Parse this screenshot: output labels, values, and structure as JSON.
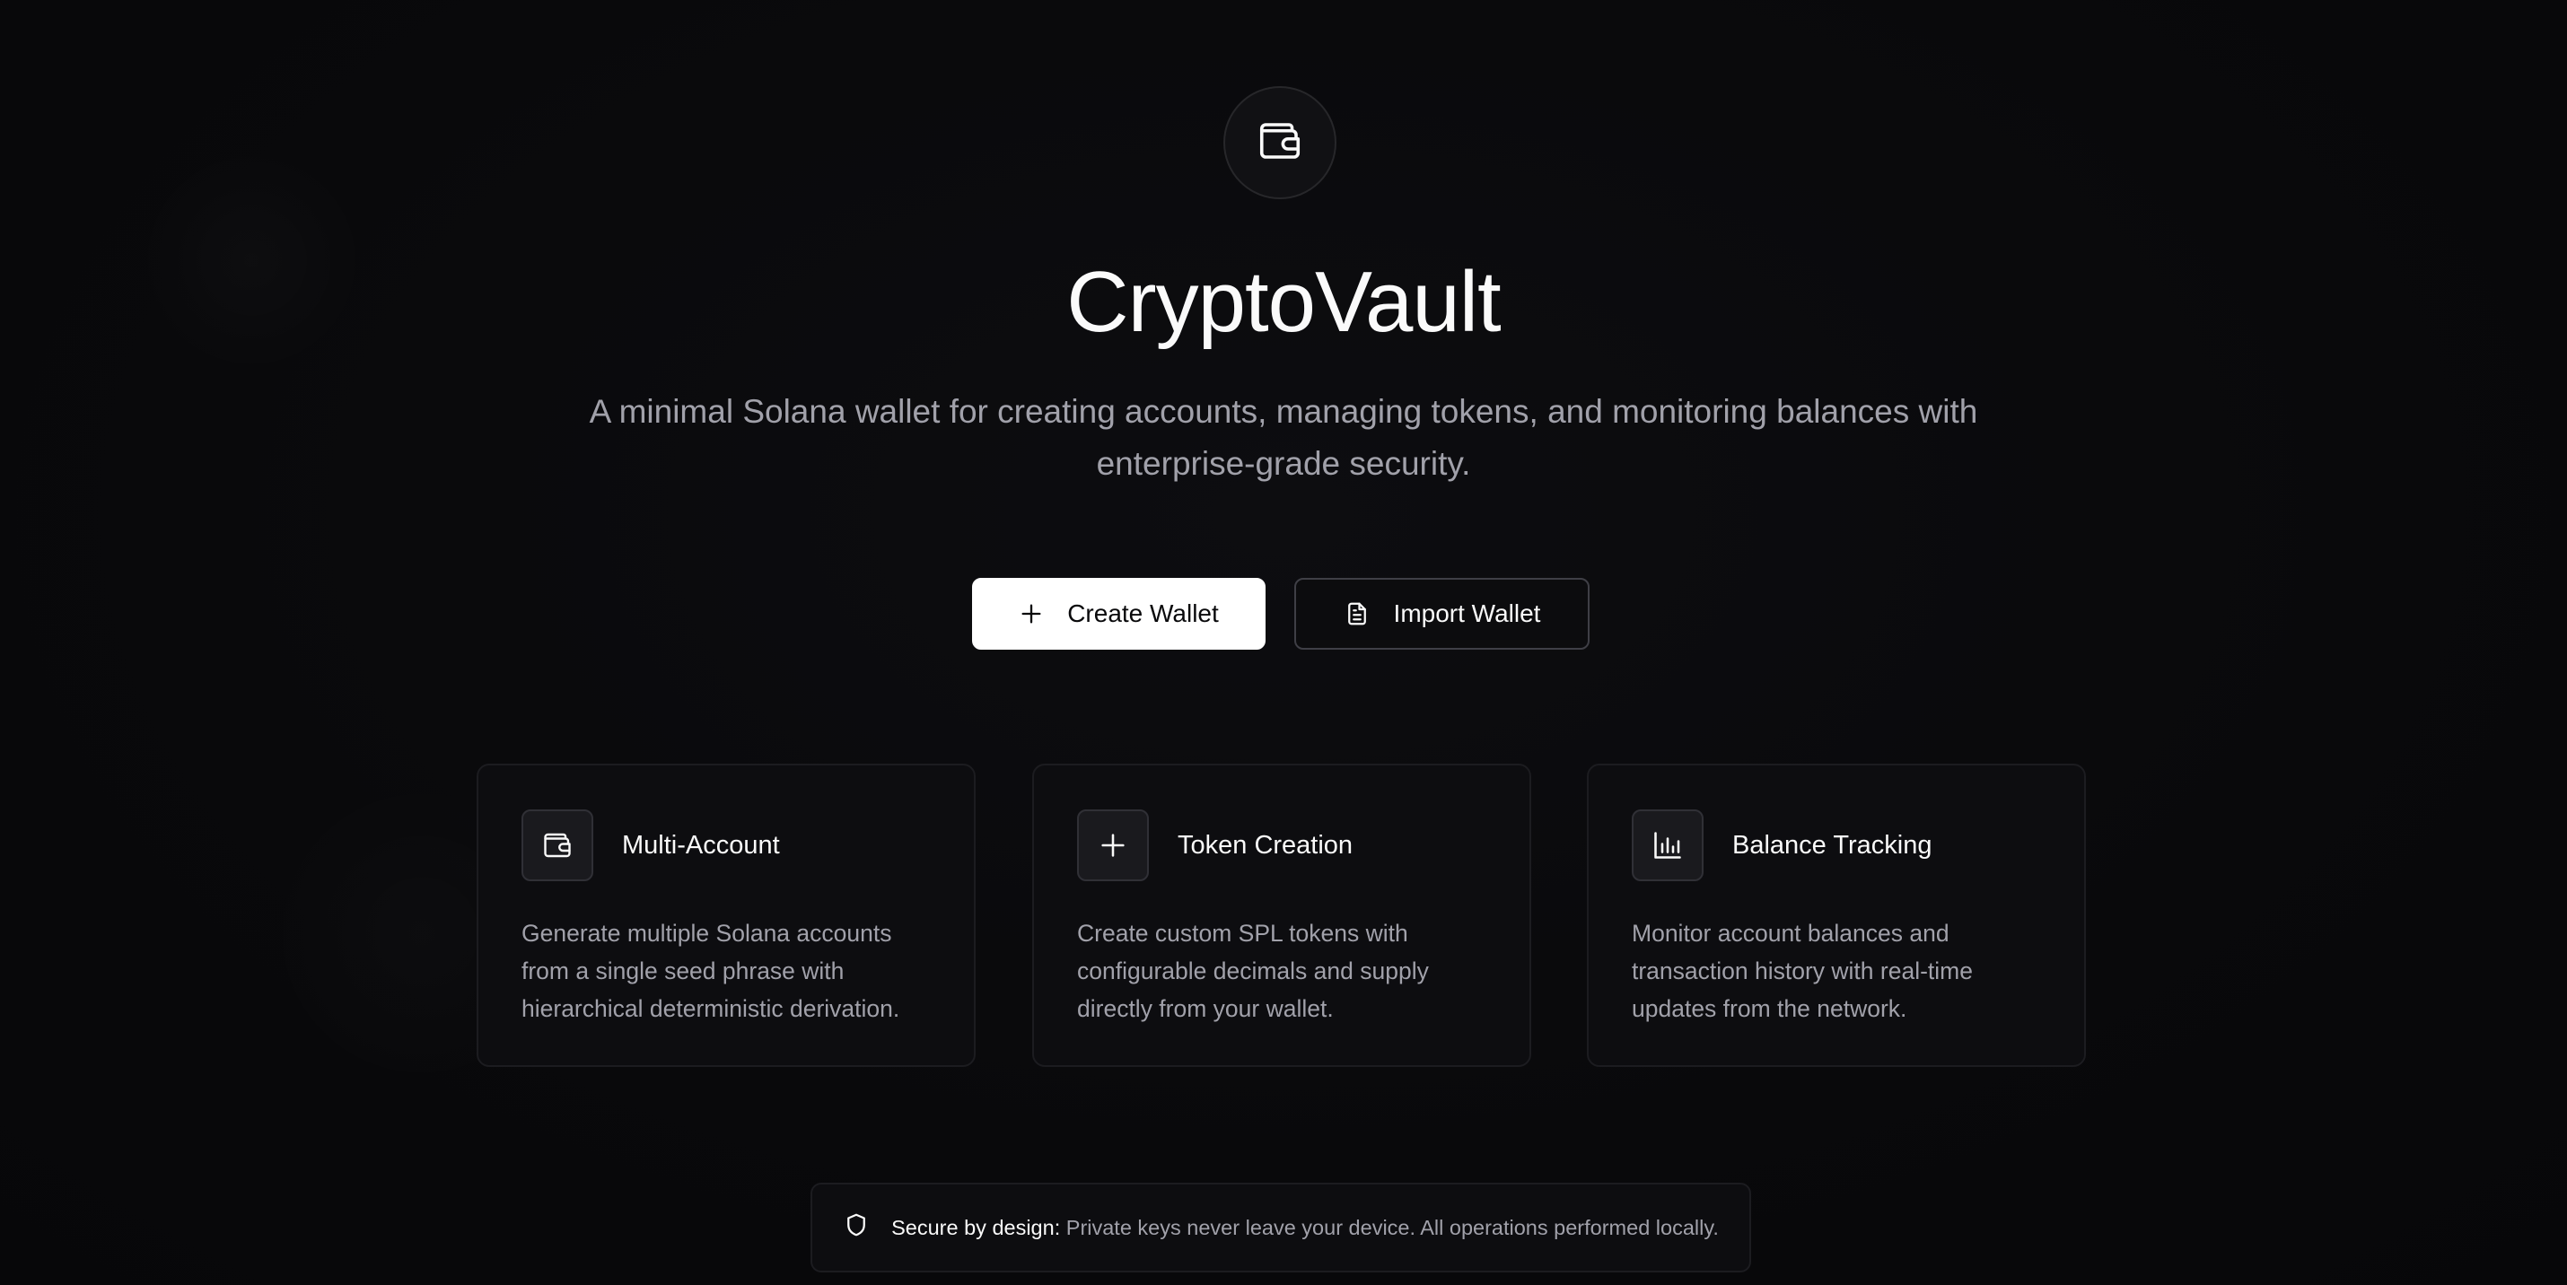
{
  "app": {
    "title": "CryptoVault",
    "subtitle": "A minimal Solana wallet for creating accounts, managing tokens, and monitoring balances with enterprise-grade security.",
    "logo_icon": "wallet-icon"
  },
  "actions": {
    "create_label": "Create Wallet",
    "create_icon": "plus-icon",
    "import_label": "Import Wallet",
    "import_icon": "file-text-icon"
  },
  "features": [
    {
      "icon": "wallet-icon",
      "title": "Multi-Account",
      "description": "Generate multiple Solana accounts from a single seed phrase with hierarchical deterministic derivation."
    },
    {
      "icon": "plus-icon",
      "title": "Token Creation",
      "description": "Create custom SPL tokens with configurable decimals and supply directly from your wallet."
    },
    {
      "icon": "bar-chart-icon",
      "title": "Balance Tracking",
      "description": "Monitor account balances and transaction history with real-time updates from the network."
    }
  ],
  "security": {
    "icon": "shield-icon",
    "label": "Secure by design:",
    "text": "Private keys never leave your device. All operations performed locally."
  },
  "colors": {
    "background": "#09090b",
    "primary_button": "#ffffff",
    "muted_text": "#a1a1aa",
    "border": "#27272a"
  }
}
